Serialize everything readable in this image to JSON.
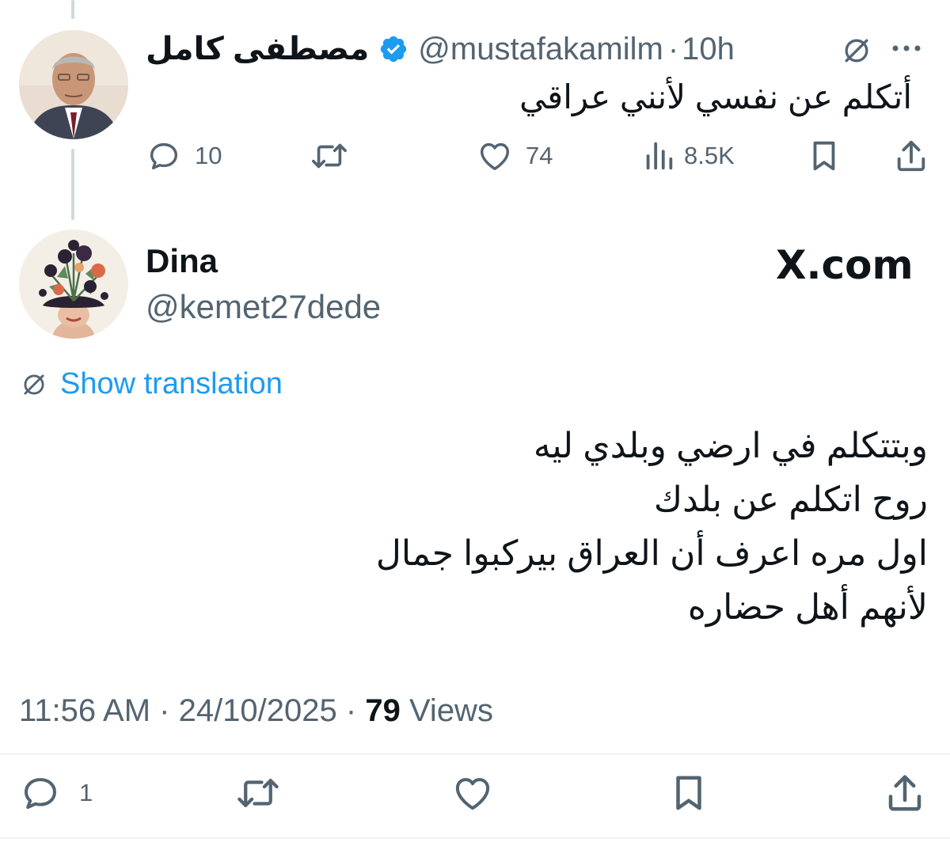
{
  "quoted_tweet": {
    "author_name": "مصطفى كامل",
    "handle": "@mustafakamilm",
    "separator": "·",
    "time": "10h",
    "text": "أتكلم عن نفسي لأنني عراقي",
    "stats": {
      "replies": "10",
      "likes": "74",
      "views": "8.5K"
    }
  },
  "main_tweet": {
    "author_name": "Dina",
    "handle": "@kemet27dede",
    "site_logo_text": "X.com",
    "translate_label": "Show translation",
    "lines": [
      "وبتتكلم في ارضي وبلدي ليه",
      "روح اتكلم عن بلدك",
      "اول مره اعرف أن العراق بيركبوا جمال",
      "لأنهم أهل حضاره"
    ],
    "timestamp": "11:56 AM · 24/10/2025 ·",
    "views_count": "79",
    "views_label": "Views",
    "stats": {
      "replies": "1"
    }
  },
  "colors": {
    "verified": "#1d9bf0",
    "link": "#1d9bf0",
    "secondary_text": "#536471",
    "thread_line": "#cfd9de"
  },
  "icons": [
    "grok-translate-icon",
    "more-icon",
    "reply-icon",
    "retweet-icon",
    "like-icon",
    "views-icon",
    "bookmark-icon",
    "share-icon",
    "verified-badge-icon"
  ]
}
